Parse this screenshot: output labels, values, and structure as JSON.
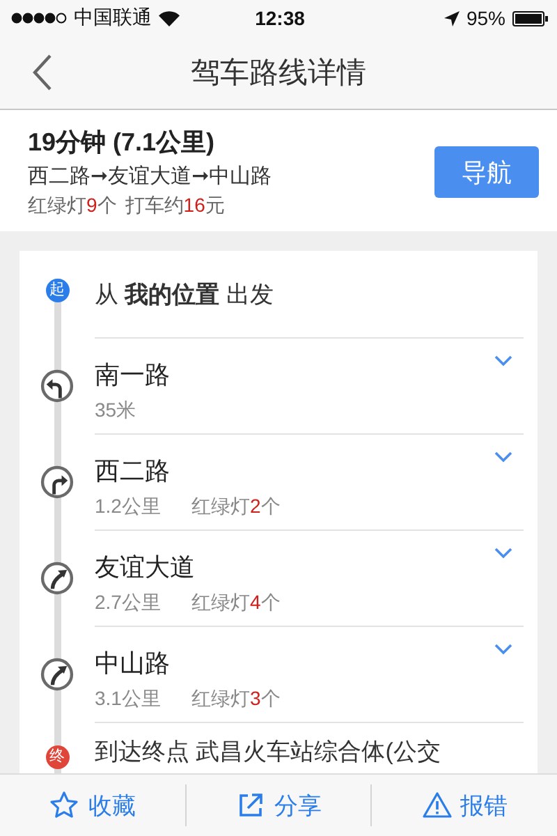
{
  "status_bar": {
    "carrier": "中国联通",
    "time": "12:38",
    "battery": "95%"
  },
  "nav_bar": {
    "title": "驾车路线详情"
  },
  "summary": {
    "duration": "19分钟 (7.1公里)",
    "route": "西二路➞友谊大道➞中山路",
    "lights_label": "红绿灯",
    "lights": "9",
    "lights_unit": "个",
    "taxi_label": "打车约",
    "taxi_price": "16",
    "taxi_unit": "元",
    "button": "导航"
  },
  "start": {
    "marker": "起",
    "text": "从 **我的位置** 出发"
  },
  "steps": [
    {
      "kind": "left",
      "road": "南一路",
      "distance": "35米"
    },
    {
      "kind": "right",
      "road": "西二路",
      "distance": "1.2公里",
      "lights_label": "红绿灯",
      "lights": "2",
      "lights_unit": "个"
    },
    {
      "kind": "bear-right",
      "road": "友谊大道",
      "distance": "2.7公里",
      "lights_label": "红绿灯",
      "lights": "4",
      "lights_unit": "个"
    },
    {
      "kind": "bear-right",
      "road": "中山路",
      "distance": "3.1公里",
      "lights_label": "红绿灯",
      "lights": "3",
      "lights_unit": "个"
    }
  ],
  "end": {
    "marker": "终",
    "text": "到达终点 武昌火车站综合体(公交"
  },
  "toolbar": [
    {
      "kind": "star",
      "label": "收藏"
    },
    {
      "kind": "share",
      "label": "分享"
    },
    {
      "kind": "warning",
      "label": "报错"
    }
  ]
}
